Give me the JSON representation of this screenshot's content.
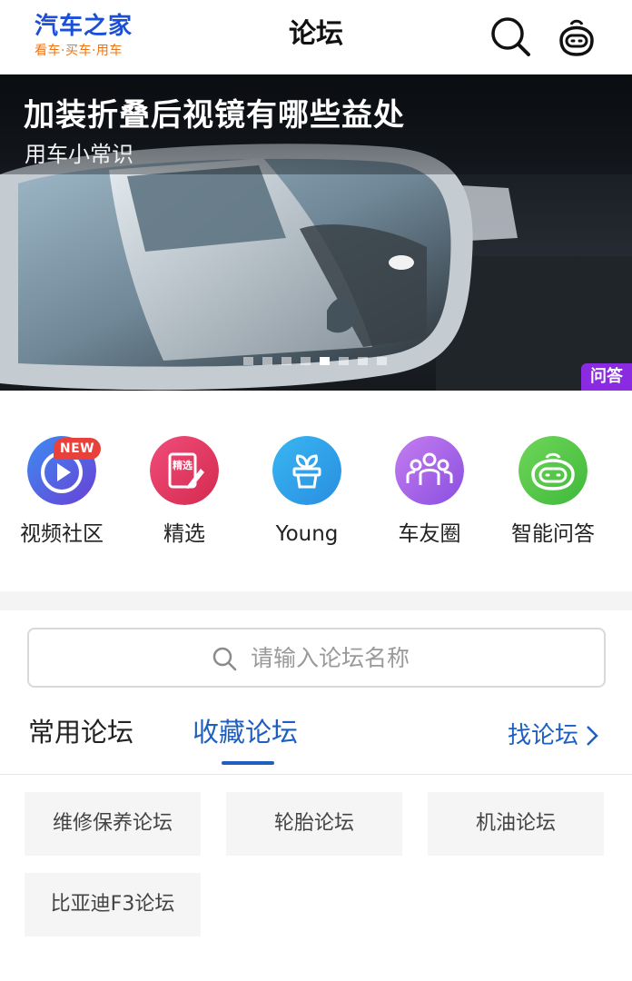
{
  "header": {
    "logo_main": "汽车之家",
    "logo_sub": "看车·买车·用车",
    "title": "论坛",
    "search_icon": "search-icon",
    "assistant_icon": "robot-icon"
  },
  "banner": {
    "title": "加装折叠后视镜有哪些益处",
    "subtitle": "用车小常识",
    "tag": "问答",
    "slide_count": 8,
    "active_slide": 5
  },
  "quick_entries": [
    {
      "label": "视频社区",
      "icon": "play-icon",
      "badge": "NEW"
    },
    {
      "label": "精选",
      "icon": "featured-icon",
      "icon_text": "精选"
    },
    {
      "label": "Young",
      "icon": "plant-icon"
    },
    {
      "label": "车友圈",
      "icon": "people-icon"
    },
    {
      "label": "智能问答",
      "icon": "robot-icon"
    }
  ],
  "forum_search": {
    "placeholder": "请输入论坛名称",
    "value": ""
  },
  "tabs": [
    {
      "label": "常用论坛",
      "active": false
    },
    {
      "label": "收藏论坛",
      "active": true
    }
  ],
  "find_forum_label": "找论坛",
  "forums": [
    {
      "label": "维修保养论坛"
    },
    {
      "label": "轮胎论坛"
    },
    {
      "label": "机油论坛"
    },
    {
      "label": "比亚迪F3论坛"
    }
  ],
  "colors": {
    "brand_blue": "#1a4fd6",
    "brand_orange": "#e8751a",
    "accent_blue": "#1e5fbf",
    "tag_purple": "#8a2be2",
    "badge_red": "#e8413c"
  }
}
